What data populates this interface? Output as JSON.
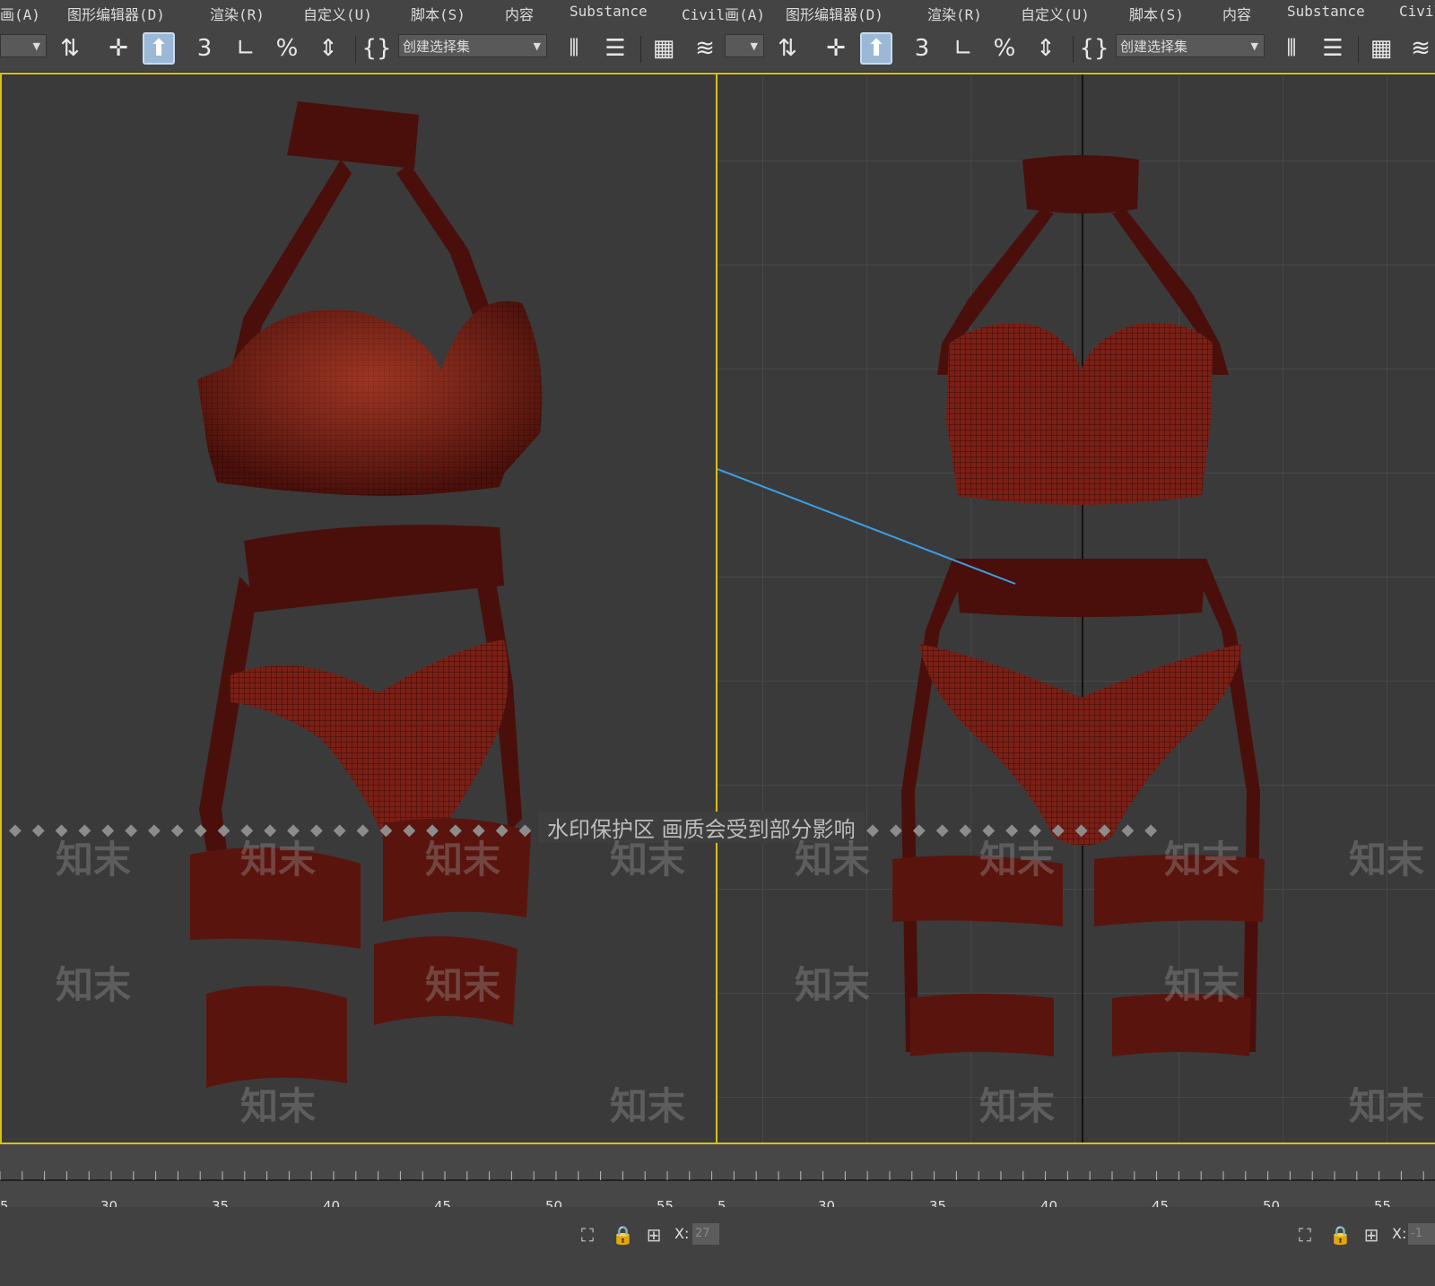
{
  "menu": {
    "left": [
      "画(A)",
      "图形编辑器(D)",
      "渲染(R)",
      "自定义(U)",
      "脚本(S)",
      "内容",
      "Substance",
      "Civil画(A)"
    ],
    "right": [
      "图形编辑器(D)",
      "渲染(R)",
      "自定义(U)",
      "脚本(S)",
      "内容",
      "Substance",
      "Civil"
    ]
  },
  "toolbar": {
    "selection_set_placeholder": "创建选择集"
  },
  "watermark": {
    "notice": "水印保护区  画质会受到部分影响",
    "tile": "知末"
  },
  "timeline": {
    "left_ticks": [
      "5",
      "30",
      "35",
      "40",
      "45",
      "50",
      "55"
    ],
    "right_ticks": [
      "5",
      "30",
      "35",
      "40",
      "45",
      "50",
      "55"
    ]
  },
  "status": {
    "x_label": "X:",
    "left_x_value": "27",
    "right_x_value": "-1"
  },
  "colors": {
    "viewport_border": "#d8c11a",
    "mesh_fill": "#6a1a12",
    "mesh_dark": "#3a0a08",
    "selection_line": "#3aa0e8"
  }
}
